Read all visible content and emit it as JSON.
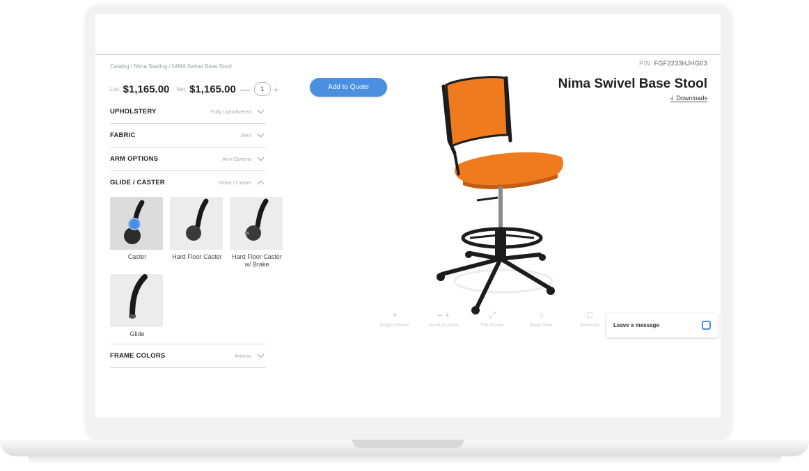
{
  "breadcrumb": "Catalog / Nima Seating / NIMA Swivel Base Stool",
  "pn": {
    "label": "P/N:",
    "value": "FGF2233HJHG03"
  },
  "pricing": {
    "list_label": "List:",
    "list_price": "$1,165.00",
    "net_label": "Net:",
    "net_price": "$1,165.00",
    "qty_minus": "—",
    "quantity": "1",
    "qty_plus": "+"
  },
  "add_to_quote": "Add to Quote",
  "product": {
    "title": "Nima Swivel Base Stool",
    "downloads": "Downloads",
    "seat_color": "#f07a1e",
    "frame_color": "#222222"
  },
  "options": [
    {
      "name": "UPHOLSTERY",
      "value": "Fully Upholstered",
      "expanded": false
    },
    {
      "name": "FABRIC",
      "value": "Alert",
      "expanded": false
    },
    {
      "name": "ARM OPTIONS",
      "value": "Arm Options",
      "expanded": false
    },
    {
      "name": "GLIDE / CASTER",
      "value": "Glide / Caster",
      "expanded": true
    },
    {
      "name": "FRAME COLORS",
      "value": "Ardena",
      "expanded": false
    }
  ],
  "casters": [
    {
      "label": "Caster",
      "selected": true
    },
    {
      "label": "Hard Floor Caster",
      "selected": false
    },
    {
      "label": "Hard Floor Caster w/ Brake",
      "selected": false
    },
    {
      "label": "Glide",
      "selected": false
    }
  ],
  "viewer_tools": [
    {
      "icon": "rotate-icon",
      "label": "Drag to Rotate"
    },
    {
      "icon": "zoom-icon",
      "label": "Scroll to Zoom"
    },
    {
      "icon": "fullscreen-icon",
      "label": "Full Screen"
    },
    {
      "icon": "reset-view-icon",
      "label": "Reset View"
    },
    {
      "icon": "download-icon",
      "label": "Download"
    }
  ],
  "leave_message": "Leave a message",
  "accent_color": "#4a8fe0"
}
